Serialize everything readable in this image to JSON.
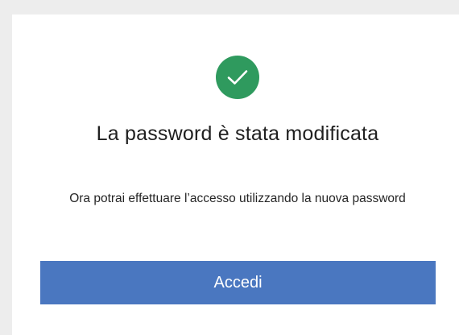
{
  "success": {
    "icon": "checkmark-icon",
    "icon_color": "#2f9a5e",
    "title": "La password è stata modificata",
    "message": "Ora potrai effettuare l’accesso utilizzando la nuova password"
  },
  "actions": {
    "login_label": "Accedi",
    "button_color": "#4a77c0"
  }
}
